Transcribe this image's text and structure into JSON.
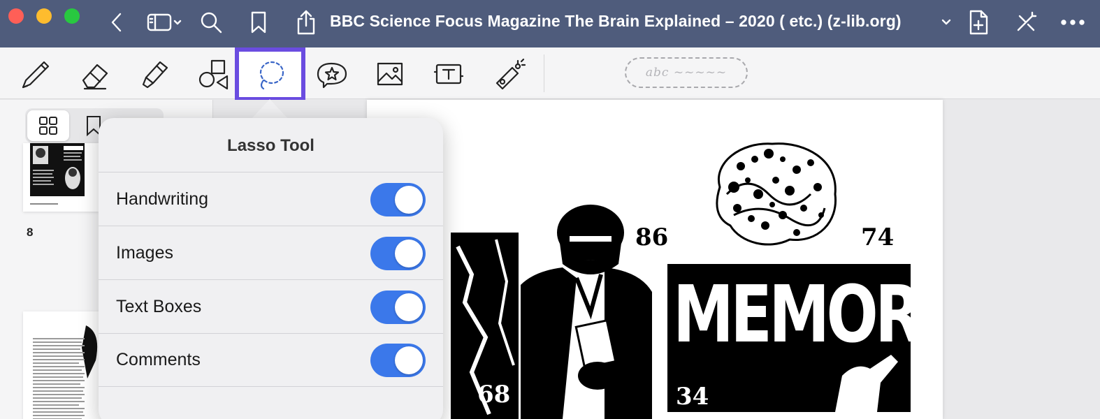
{
  "window": {
    "title": "BBC Science Focus Magazine The Brain Explained – 2020 ( etc.) (z-lib.org)",
    "colors": {
      "titlebar": "#4f5c7c",
      "close": "#ff5f57",
      "minimize": "#febc2e",
      "zoom": "#28c840",
      "accent": "#6a4ce0",
      "toggle_on": "#3b78ea"
    }
  },
  "toolbar": {
    "tools": [
      "pen-icon",
      "eraser-icon",
      "highlighter-icon",
      "shapes-icon",
      "lasso-icon",
      "sticker-icon",
      "image-icon",
      "text-box-icon",
      "laser-pointer-icon"
    ],
    "selected_tool": "lasso-icon",
    "handwriting_placeholder": "abc ~~~~~"
  },
  "sidebar": {
    "page_number": "8"
  },
  "document": {
    "numbers": [
      "86",
      "74",
      "68",
      "34"
    ],
    "headline": "MEMORY"
  },
  "popover": {
    "title": "Lasso Tool",
    "options": [
      {
        "label": "Handwriting",
        "on": true
      },
      {
        "label": "Images",
        "on": true
      },
      {
        "label": "Text Boxes",
        "on": true
      },
      {
        "label": "Comments",
        "on": true
      }
    ]
  }
}
